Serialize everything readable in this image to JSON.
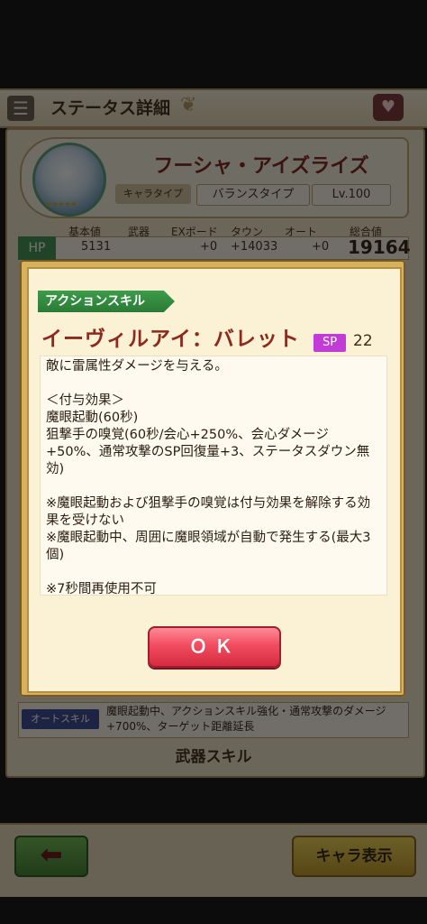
{
  "header": {
    "title": "ステータス詳細"
  },
  "character": {
    "name": "フーシャ・アイズライズ",
    "type_label": "キャラタイプ",
    "type_value": "バランスタイプ",
    "level": "Lv.100"
  },
  "stats": {
    "headers": [
      "基本値",
      "武器",
      "EXボード",
      "タウン",
      "オート",
      "総合値"
    ],
    "hp_label": "HP",
    "hp_values": [
      "5131",
      "",
      "+0",
      "+14033",
      "+0",
      "19164"
    ]
  },
  "auto_skill": {
    "label": "オートスキル",
    "text": "魔眼起動中、アクションスキル強化・通常攻撃のダメージ+700%、ターゲット距離延長"
  },
  "weapon_skill_title": "武器スキル",
  "bottom": {
    "chara_button": "キャラ表示"
  },
  "dialog": {
    "tag": "アクションスキル",
    "skill_name": "イーヴィルアイ：バレット",
    "sp_label": "SP",
    "sp_value": "22",
    "description": "敵に雷属性ダメージを与える。\n\n＜付与効果＞\n魔眼起動(60秒)\n狙撃手の嗅覚(60秒/会心+250%、会心ダメージ+50%、通常攻撃のSP回復量+3、ステータスダウン無効)\n\n※魔眼起動および狙撃手の嗅覚は付与効果を解除する効果を受けない\n※魔眼起動中、周囲に魔眼領域が自動で発生する(最大3個)\n\n※7秒間再使用不可",
    "ok_label": "ＯＫ"
  },
  "icons": {
    "menu": "menu-icon",
    "heart": "heart-icon",
    "back": "back-arrow-icon"
  },
  "colors": {
    "dialog_frame": "#d7b25e",
    "skill_name": "#8c2a1e",
    "ok_button": "#f14d60",
    "sp_badge": "#c23bd6",
    "tag_green": "#3d9c4a"
  }
}
